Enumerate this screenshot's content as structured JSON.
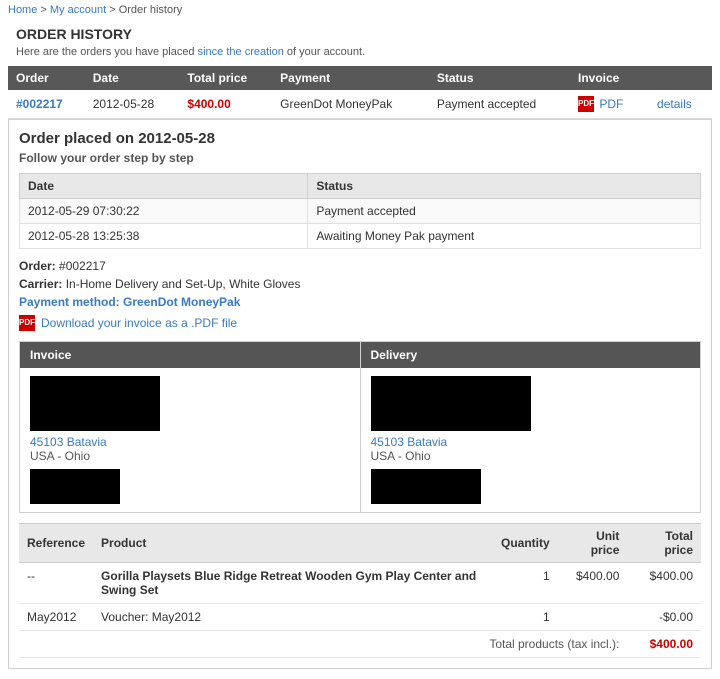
{
  "breadcrumb": {
    "items": [
      "Home",
      "My account",
      "Order history"
    ],
    "links": [
      true,
      true,
      false
    ]
  },
  "page": {
    "title": "ORDER HISTORY",
    "subtitle": "Here are the orders you have placed since the creation of your account."
  },
  "orders_table": {
    "headers": [
      "Order",
      "Date",
      "Total price",
      "Payment",
      "Status",
      "Invoice"
    ],
    "rows": [
      {
        "order_id": "#002217",
        "date": "2012-05-28",
        "total": "$400.00",
        "payment": "GreenDot MoneyPak",
        "status": "Payment accepted",
        "pdf_label": "PDF",
        "details_label": "details"
      }
    ]
  },
  "order_detail": {
    "title": "Order placed on 2012-05-28",
    "subtitle": "Follow your order step by step",
    "steps_headers": [
      "Date",
      "Status"
    ],
    "steps": [
      {
        "date": "2012-05-29 07:30:22",
        "status": "Payment accepted"
      },
      {
        "date": "2012-05-28 13:25:38",
        "status": "Awaiting Money Pak payment"
      }
    ],
    "order_number_label": "Order:",
    "order_number": "#002217",
    "carrier_label": "Carrier:",
    "carrier": "In-Home Delivery and Set-Up, White Gloves",
    "payment_label": "Payment method:",
    "payment": "GreenDot MoneyPak",
    "download_label": "Download your invoice as a .PDF file",
    "invoice_header": "Invoice",
    "delivery_header": "Delivery",
    "address_city": "45103 Batavia",
    "address_country": "USA - Ohio"
  },
  "products_table": {
    "headers": [
      "Reference",
      "Product",
      "Quantity",
      "Unit price",
      "Total price"
    ],
    "rows": [
      {
        "reference": "--",
        "product": "Gorilla Playsets Blue Ridge Retreat Wooden Gym Play Center and Swing Set",
        "quantity": "1",
        "unit_price": "$400.00",
        "total_price": "$400.00"
      },
      {
        "reference": "May2012",
        "product": "Voucher: May2012",
        "quantity": "1",
        "unit_price": "",
        "total_price": "-$0.00"
      }
    ],
    "total_products_label": "Total products (tax incl.):",
    "total_products_value": "$400.00"
  }
}
